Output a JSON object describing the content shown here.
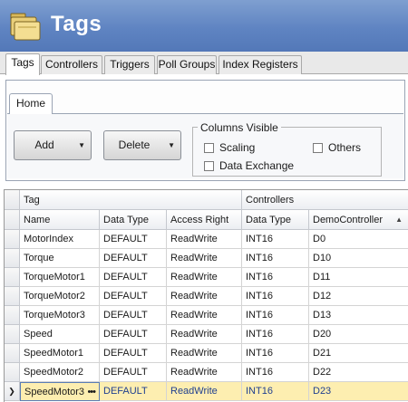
{
  "app": {
    "title": "Tags",
    "icon": "folders-icon",
    "colors": {
      "title_bar": "#5f84c2",
      "selected_row": "#fdeeb0"
    }
  },
  "tabs": [
    {
      "label": "Tags",
      "active": true
    },
    {
      "label": "Controllers",
      "active": false
    },
    {
      "label": "Triggers",
      "active": false
    },
    {
      "label": "Poll Groups",
      "active": false
    },
    {
      "label": "Index Registers",
      "active": false
    }
  ],
  "ribbon": {
    "tab_label": "Home",
    "add_label": "Add",
    "delete_label": "Delete",
    "columns_visible": {
      "title": "Columns Visible",
      "options": [
        {
          "label": "Scaling",
          "checked": false
        },
        {
          "label": "Others",
          "checked": false
        },
        {
          "label": "Data Exchange",
          "checked": false
        }
      ]
    }
  },
  "grid": {
    "group_headers": {
      "tag": "Tag",
      "controllers": "Controllers"
    },
    "columns": [
      "Name",
      "Data Type",
      "Access Right",
      "Data Type",
      "DemoController"
    ],
    "sort_column": "DemoController",
    "sort_direction": "ascending",
    "rows": [
      [
        "MotorIndex",
        "DEFAULT",
        "ReadWrite",
        "INT16",
        "D0"
      ],
      [
        "Torque",
        "DEFAULT",
        "ReadWrite",
        "INT16",
        "D10"
      ],
      [
        "TorqueMotor1",
        "DEFAULT",
        "ReadWrite",
        "INT16",
        "D11"
      ],
      [
        "TorqueMotor2",
        "DEFAULT",
        "ReadWrite",
        "INT16",
        "D12"
      ],
      [
        "TorqueMotor3",
        "DEFAULT",
        "ReadWrite",
        "INT16",
        "D13"
      ],
      [
        "Speed",
        "DEFAULT",
        "ReadWrite",
        "INT16",
        "D20"
      ],
      [
        "SpeedMotor1",
        "DEFAULT",
        "ReadWrite",
        "INT16",
        "D21"
      ],
      [
        "SpeedMotor2",
        "DEFAULT",
        "ReadWrite",
        "INT16",
        "D22"
      ],
      [
        "SpeedMotor3",
        "DEFAULT",
        "ReadWrite",
        "INT16",
        "D23"
      ]
    ],
    "selected_row": 8,
    "editing_cell_ellipsis": "•••",
    "row_indicator": "❯"
  }
}
